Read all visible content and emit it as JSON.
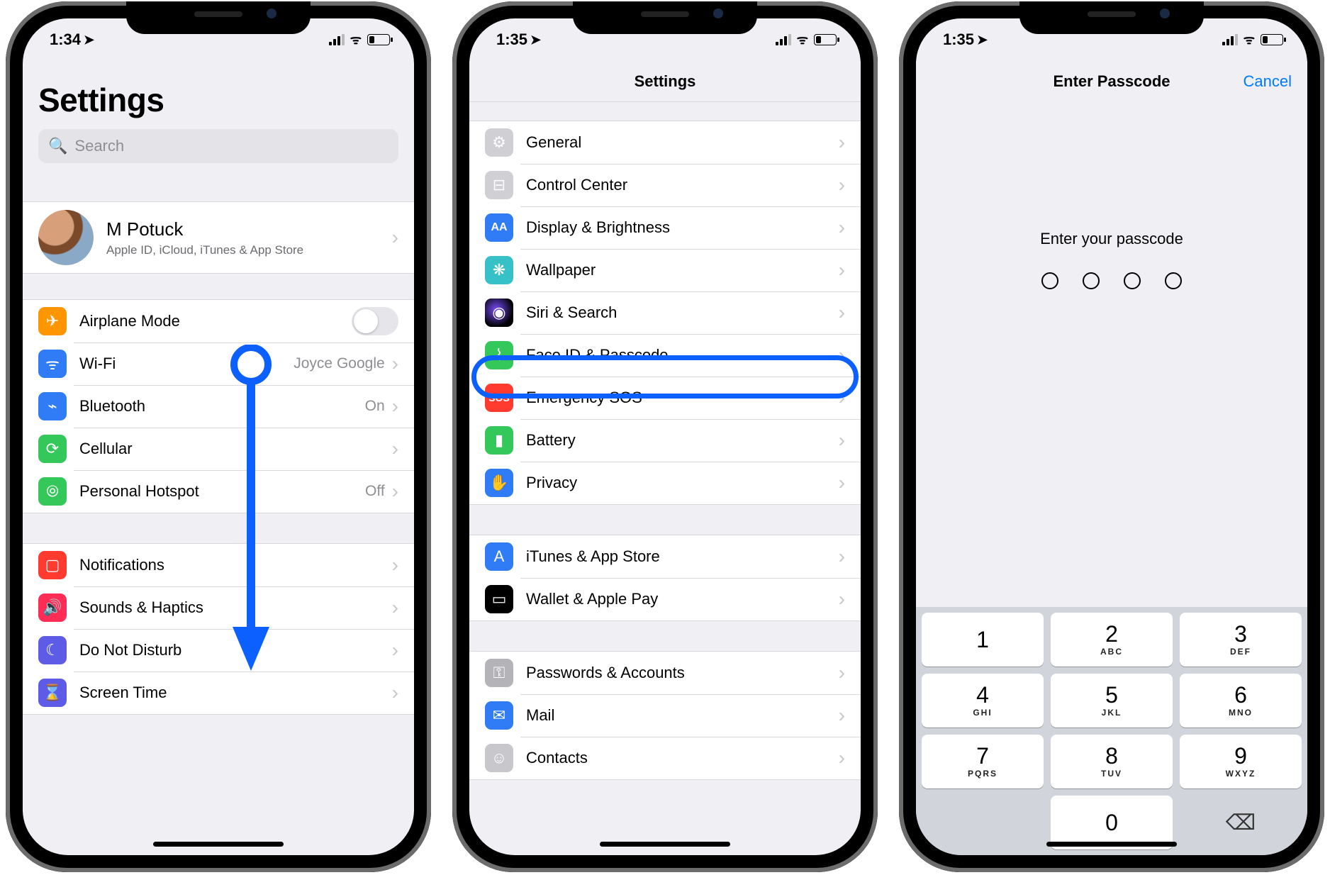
{
  "screen1": {
    "status": {
      "time": "1:34",
      "loc_icon": "➤"
    },
    "title": "Settings",
    "search": {
      "placeholder": "Search"
    },
    "id": {
      "name": "M Potuck",
      "sub": "Apple ID, iCloud, iTunes & App Store"
    },
    "group1": [
      {
        "icon": "airplane",
        "glyph": "✈",
        "label": "Airplane Mode",
        "type": "toggle",
        "on": false
      },
      {
        "icon": "wifi",
        "glyph": "ᯤ",
        "label": "Wi-Fi",
        "detail": "Joyce Google"
      },
      {
        "icon": "bt",
        "glyph": "⌁",
        "label": "Bluetooth",
        "detail": "On"
      },
      {
        "icon": "cell",
        "glyph": "⟳",
        "label": "Cellular"
      },
      {
        "icon": "hotspot",
        "glyph": "⦾",
        "label": "Personal Hotspot",
        "detail": "Off"
      }
    ],
    "group2": [
      {
        "icon": "notif",
        "glyph": "▢",
        "label": "Notifications"
      },
      {
        "icon": "sounds",
        "glyph": "🔊",
        "label": "Sounds & Haptics"
      },
      {
        "icon": "dnd",
        "glyph": "☾",
        "label": "Do Not Disturb"
      },
      {
        "icon": "screentime",
        "glyph": "⌛",
        "label": "Screen Time"
      }
    ]
  },
  "screen2": {
    "status": {
      "time": "1:35"
    },
    "title": "Settings",
    "groups": [
      [
        {
          "icon": "general",
          "glyph": "⚙",
          "label": "General"
        },
        {
          "icon": "cc",
          "glyph": "⊟",
          "label": "Control Center"
        },
        {
          "icon": "display",
          "glyph": "AA",
          "label": "Display & Brightness"
        },
        {
          "icon": "wall",
          "glyph": "❋",
          "label": "Wallpaper"
        },
        {
          "icon": "siri",
          "glyph": "◉",
          "label": "Siri & Search"
        },
        {
          "icon": "faceid",
          "glyph": "⌇",
          "label": "Face ID & Passcode",
          "highlight": true
        },
        {
          "icon": "sos",
          "glyph": "SOS",
          "label": "Emergency SOS"
        },
        {
          "icon": "battery",
          "glyph": "▮",
          "label": "Battery"
        },
        {
          "icon": "privacy",
          "glyph": "✋",
          "label": "Privacy"
        }
      ],
      [
        {
          "icon": "itunes",
          "glyph": "A",
          "label": "iTunes & App Store"
        },
        {
          "icon": "wallet",
          "glyph": "▭",
          "label": "Wallet & Apple Pay"
        }
      ],
      [
        {
          "icon": "passwords",
          "glyph": "⚿",
          "label": "Passwords & Accounts"
        },
        {
          "icon": "mail",
          "glyph": "✉",
          "label": "Mail"
        },
        {
          "icon": "contacts",
          "glyph": "☺",
          "label": "Contacts"
        }
      ]
    ]
  },
  "screen3": {
    "status": {
      "time": "1:35"
    },
    "title": "Enter Passcode",
    "cancel": "Cancel",
    "message": "Enter your passcode",
    "entered": 0,
    "length": 4,
    "keypad": [
      {
        "n": "1",
        "l": ""
      },
      {
        "n": "2",
        "l": "ABC"
      },
      {
        "n": "3",
        "l": "DEF"
      },
      {
        "n": "4",
        "l": "GHI"
      },
      {
        "n": "5",
        "l": "JKL"
      },
      {
        "n": "6",
        "l": "MNO"
      },
      {
        "n": "7",
        "l": "PQRS"
      },
      {
        "n": "8",
        "l": "TUV"
      },
      {
        "n": "9",
        "l": "WXYZ"
      },
      {
        "blank": true
      },
      {
        "n": "0",
        "l": ""
      },
      {
        "del": true,
        "glyph": "⌫"
      }
    ]
  },
  "annotation": {
    "arrow_color": "#0b60ff"
  }
}
